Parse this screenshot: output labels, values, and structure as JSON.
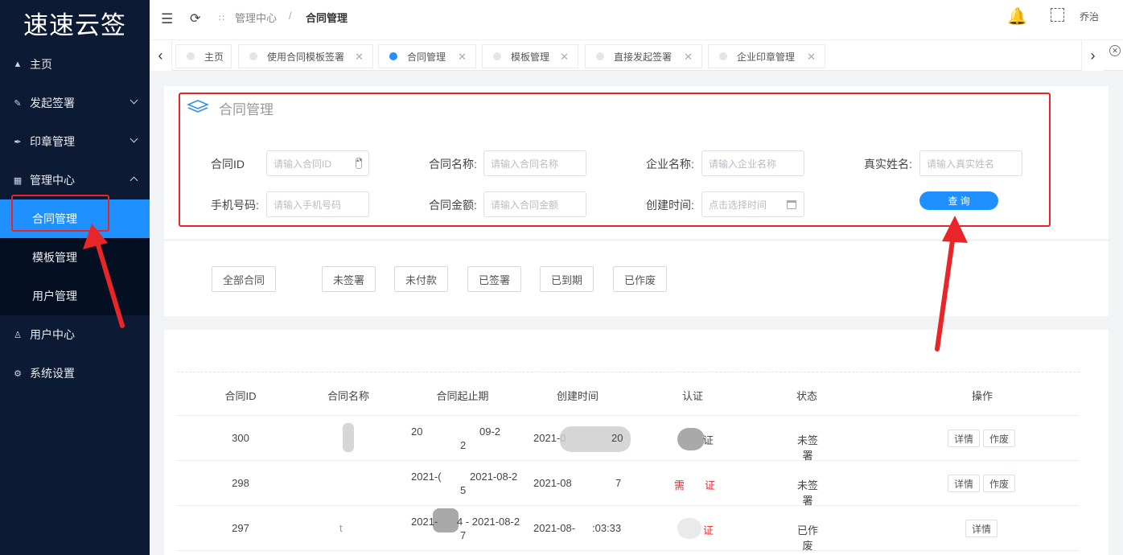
{
  "app": {
    "logo": "速速云签",
    "user": "乔治"
  },
  "sidebar": {
    "items": [
      {
        "label": "主页",
        "icon": "home-icon"
      },
      {
        "label": "发起签署",
        "icon": "edit-icon"
      },
      {
        "label": "印章管理",
        "icon": "brush-icon"
      },
      {
        "label": "管理中心",
        "icon": "grid-icon"
      },
      {
        "label": "用户中心",
        "icon": "user-icon"
      },
      {
        "label": "系统设置",
        "icon": "gear-icon"
      }
    ],
    "sub": [
      {
        "label": "合同管理"
      },
      {
        "label": "模板管理"
      },
      {
        "label": "用户管理"
      }
    ]
  },
  "header": {
    "breadcrumb_root": "管理中心",
    "breadcrumb_sep": "/",
    "breadcrumb_current": "合同管理"
  },
  "tabs": [
    {
      "label": "主页"
    },
    {
      "label": "使用合同模板签署"
    },
    {
      "label": "合同管理"
    },
    {
      "label": "模板管理"
    },
    {
      "label": "直接发起签署"
    },
    {
      "label": "企业印章管理"
    }
  ],
  "search": {
    "title": "合同管理",
    "contract_id_label": "合同ID",
    "contract_id_ph": "请输入合同ID",
    "contract_name_label": "合同名称:",
    "contract_name_ph": "请输入合同名称",
    "company_label": "企业名称:",
    "company_ph": "请输入企业名称",
    "realname_label": "真实姓名:",
    "realname_ph": "请输入真实姓名",
    "phone_label": "手机号码:",
    "phone_ph": "请输入手机号码",
    "amount_label": "合同金额:",
    "amount_ph": "请输入合同金额",
    "created_label": "创建时间:",
    "created_ph": "点击选择时间",
    "query_button": "查 询"
  },
  "filters": [
    "全部合同",
    "未签署",
    "未付款",
    "已签署",
    "已到期",
    "已作废"
  ],
  "table": {
    "headers": [
      "合同ID",
      "合同名称",
      "合同起止期",
      "创建时间",
      "认证",
      "状态",
      "操作"
    ],
    "rows": [
      {
        "id": "300",
        "name": "",
        "period1": "20",
        "period2": "09-2",
        "period3": "2",
        "created1": "2021-0",
        "created2": "20",
        "auth": "证",
        "status": "未签署",
        "ops": [
          "详情",
          "作废"
        ]
      },
      {
        "id": "298",
        "name": "",
        "period1": "2021-(",
        "period2": "2021-08-2",
        "period3": "5",
        "created1": "2021-08",
        "created2": "7",
        "auth": "证",
        "status": "未签署",
        "ops": [
          "详情",
          "作废"
        ]
      },
      {
        "id": "297",
        "name": "t",
        "period1": "2021-",
        "period2": "4 - 2021-08-2",
        "period3": "7",
        "created1": "2021-08-",
        "created2": ":03:33",
        "auth": "证",
        "status": "已作废",
        "ops": [
          "详情"
        ]
      }
    ]
  },
  "colors": {
    "accent": "#1e90ff",
    "sidebar": "#0c1a33",
    "annotation": "#e8262a"
  }
}
